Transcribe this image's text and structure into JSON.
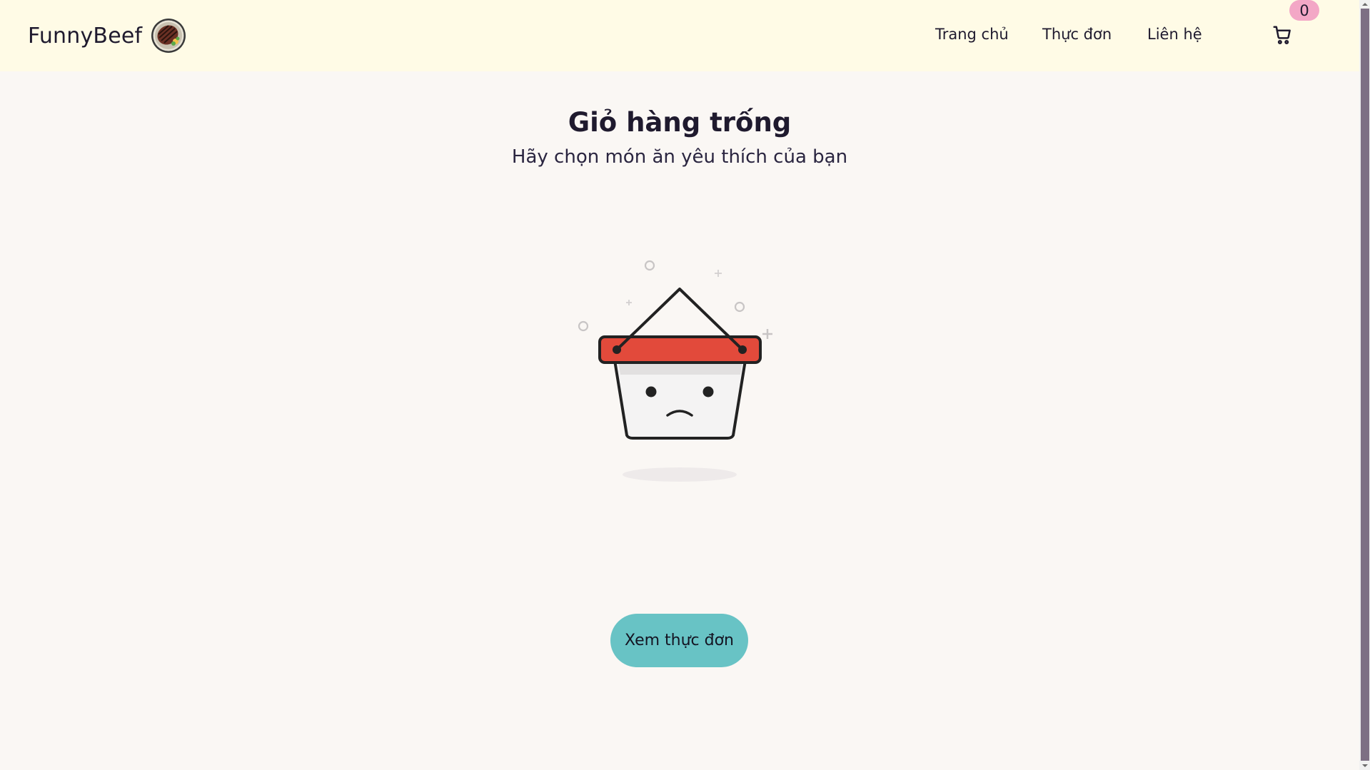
{
  "header": {
    "brand_name": "FunnyBeef",
    "nav": [
      "Trang chủ",
      "Thực đơn",
      "Liên hệ"
    ],
    "cart_count": "0",
    "cart_icon": "shopping-cart-icon"
  },
  "main": {
    "title": "Giỏ hàng trống",
    "subtitle": "Hãy chọn món ăn yêu thích của bạn",
    "illustration": "sad-empty-basket-icon",
    "cta_label": "Xem thực đơn"
  },
  "colors": {
    "header_bg": "#fffbe6",
    "page_bg": "#faf7f4",
    "basket_rim": "#e24a3b",
    "cta_bg": "#68c3c5",
    "badge_bg": "#f3a7c6",
    "scrollbar_thumb": "#7d6f84"
  }
}
